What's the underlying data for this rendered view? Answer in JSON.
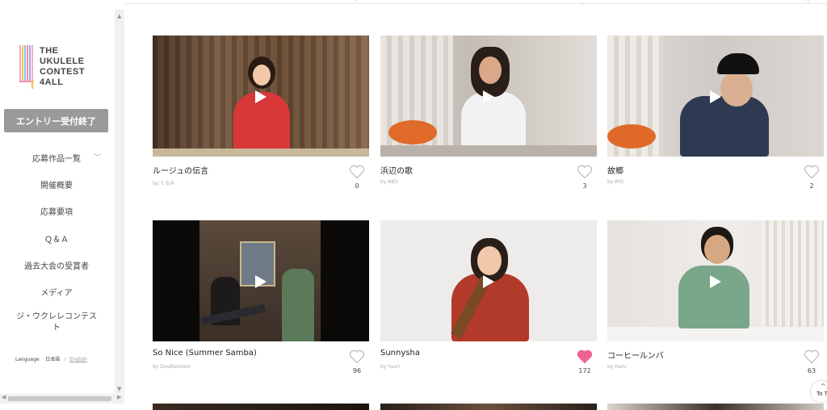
{
  "logo": {
    "line1": "THE",
    "line2": "UKULELE",
    "line3": "CONTEST",
    "line4": "4ALL",
    "bar_colors": [
      "#f7a8c8",
      "#f4c542",
      "#7dc6e8",
      "#f48fb1",
      "#b39ddb",
      "#f7a8c8"
    ]
  },
  "sidebar": {
    "entry_button": "エントリー受付終了",
    "nav": [
      {
        "label": "応募作品一覧"
      },
      {
        "label": "開催概要"
      },
      {
        "label": "応募要項"
      },
      {
        "label": "Ｑ＆Ａ"
      },
      {
        "label": "過去大会の受賞者"
      },
      {
        "label": "メディア"
      },
      {
        "label": "ジ・ウクレレコンテスト"
      }
    ],
    "language": {
      "label": "Language",
      "ja": "日本語",
      "sep": "/",
      "en": "English"
    }
  },
  "cards": [
    {
      "title": "ルージュの伝言",
      "by": "by くるみ",
      "likes": "0",
      "liked": false,
      "bg": "#6b5240"
    },
    {
      "title": "浜辺の歌",
      "by": "by AKO",
      "likes": "3",
      "liked": false,
      "bg": "#cfc8c2"
    },
    {
      "title": "故郷",
      "by": "by RIO",
      "likes": "2",
      "liked": false,
      "bg": "#d2cdc8"
    },
    {
      "title": "So Nice (Summer Samba)",
      "by": "by Doublemoon",
      "likes": "96",
      "liked": false,
      "bg": "#2a2420"
    },
    {
      "title": "Sunnysha",
      "by": "by Yuuri",
      "likes": "172",
      "liked": true,
      "bg": "#e9e7e4"
    },
    {
      "title": "コーヒールンバ",
      "by": "by Haru",
      "likes": "63",
      "liked": false,
      "bg": "#e8e6e3"
    }
  ],
  "to_top": "To T",
  "colors": {
    "heart_outline": "#bdbdbd",
    "heart_filled": "#f06292",
    "accent": "#9a9a9a"
  }
}
